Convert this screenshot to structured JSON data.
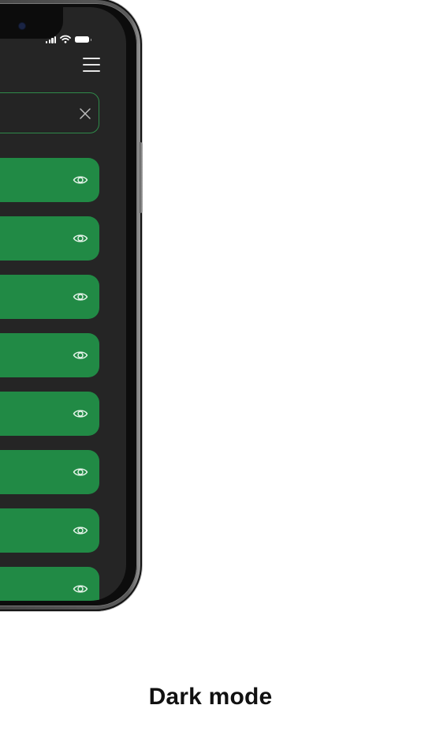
{
  "search": {
    "value": "",
    "placeholder": ""
  },
  "list": {
    "items": [
      {
        "label": "",
        "icon": "eye-icon"
      },
      {
        "label": "",
        "icon": "eye-icon"
      },
      {
        "label": "",
        "icon": "eye-icon"
      },
      {
        "label": "",
        "icon": "eye-icon"
      },
      {
        "label": "",
        "icon": "eye-icon"
      },
      {
        "label": "",
        "icon": "eye-icon"
      },
      {
        "label": "",
        "icon": "eye-icon"
      },
      {
        "label": "",
        "icon": "eye-icon"
      }
    ]
  },
  "caption": {
    "text": "Dark mode"
  },
  "colors": {
    "screen_background": "#252525",
    "accent_green": "#218a45",
    "search_border": "#2f8a4a",
    "page_background": "#ffffff",
    "caption_text": "#111111"
  },
  "icons": {
    "status": [
      "signal-icon",
      "wifi-icon",
      "battery-icon"
    ],
    "header": "menu-icon",
    "search_clear": "close-icon",
    "row_action": "eye-icon"
  }
}
